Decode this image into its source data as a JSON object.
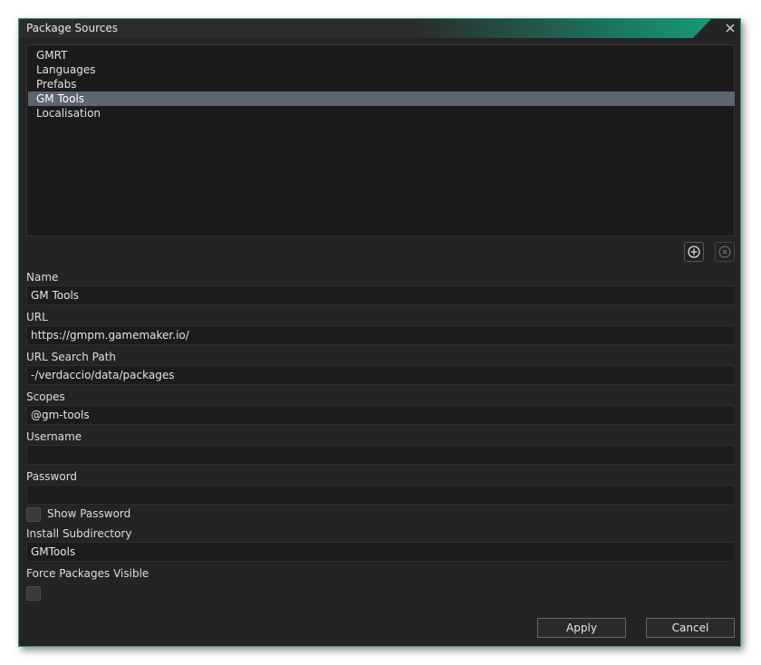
{
  "window": {
    "title": "Package Sources",
    "close_icon": "close-icon"
  },
  "sources": {
    "items": [
      "GMRT",
      "Languages",
      "Prefabs",
      "GM Tools",
      "Localisation"
    ],
    "selected": "GM Tools"
  },
  "toolbar": {
    "add_icon": "add-circle-icon",
    "remove_icon": "remove-circle-icon"
  },
  "form": {
    "name_label": "Name",
    "name_value": "GM Tools",
    "url_label": "URL",
    "url_value": "https://gmpm.gamemaker.io/",
    "search_path_label": "URL Search Path",
    "search_path_value": "-/verdaccio/data/packages",
    "scopes_label": "Scopes",
    "scopes_value": "@gm-tools",
    "username_label": "Username",
    "username_value": "",
    "password_label": "Password",
    "password_value": "",
    "show_password_label": "Show Password",
    "show_password_checked": false,
    "install_subdir_label": "Install Subdirectory",
    "install_subdir_value": "GMTools",
    "force_visible_label": "Force Packages Visible",
    "force_visible_checked": false
  },
  "buttons": {
    "apply": "Apply",
    "cancel": "Cancel"
  },
  "colors": {
    "accent": "#16a383",
    "selection": "#5d6472",
    "background": "#242424"
  }
}
